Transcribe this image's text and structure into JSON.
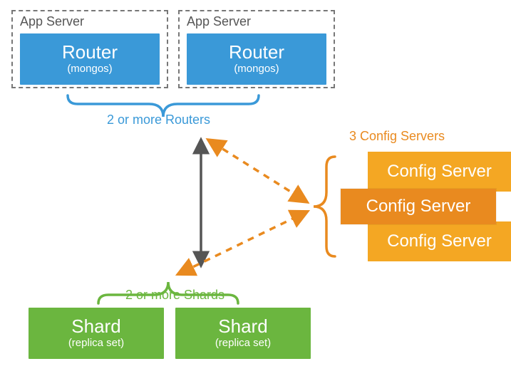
{
  "appServers": [
    {
      "box_label": "App Server",
      "title": "Router",
      "sub": "(mongos)"
    },
    {
      "box_label": "App Server",
      "title": "Router",
      "sub": "(mongos)"
    }
  ],
  "captions": {
    "routers": "2 or more Routers",
    "shards": "2 or more Shards",
    "config": "3 Config Servers"
  },
  "configServers": [
    {
      "label": "Config Server"
    },
    {
      "label": "Config Server"
    },
    {
      "label": "Config Server"
    }
  ],
  "shards": [
    {
      "title": "Shard",
      "sub": "(replica set)"
    },
    {
      "title": "Shard",
      "sub": "(replica set)"
    }
  ],
  "colors": {
    "blue": "#3A99D8",
    "green": "#6BB63F",
    "orangeLight": "#F4A723",
    "orangeDark": "#E98A1F",
    "gray": "#555"
  }
}
